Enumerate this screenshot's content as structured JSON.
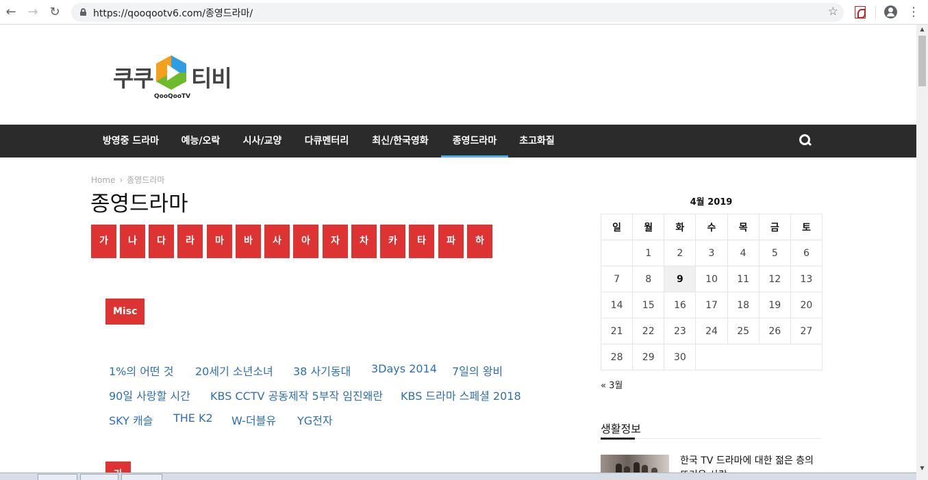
{
  "browser": {
    "url": "https://qooqootv6.com/종영드라마/"
  },
  "site": {
    "logo_ko_left": "쿠쿠",
    "logo_ko_right": "티비",
    "logo_en": "QooQooTV",
    "menu": [
      {
        "label": "방영중 드라마",
        "active": false
      },
      {
        "label": "예능/오락",
        "active": false
      },
      {
        "label": "시사/교양",
        "active": false
      },
      {
        "label": "다큐멘터리",
        "active": false
      },
      {
        "label": "최신/한국영화",
        "active": false
      },
      {
        "label": "종영드라마",
        "active": true
      },
      {
        "label": "초고화질",
        "active": false
      }
    ]
  },
  "breadcrumb": {
    "home": "Home",
    "arrow": "›",
    "current": "종영드라마"
  },
  "page_title": "종영드라마",
  "letters": [
    "가",
    "나",
    "다",
    "라",
    "마",
    "바",
    "사",
    "아",
    "자",
    "차",
    "카",
    "타",
    "파",
    "하"
  ],
  "sections": [
    {
      "label": "Misc",
      "links": [
        [
          "1%의 어떤 것",
          "20세기 소년소녀",
          "38 사기동대",
          "3Days 2014",
          "7일의 왕비"
        ],
        [
          "90일 사랑할 시간",
          "KBS CCTV 공동제작 5부작 임진왜란",
          "KBS 드라마 스페셜 2018"
        ],
        [
          "SKY 캐슬",
          "THE K2",
          "W-더블유",
          "YG전자"
        ]
      ]
    },
    {
      "label": "가"
    }
  ],
  "calendar": {
    "caption": "4월 2019",
    "weekdays": [
      "일",
      "월",
      "화",
      "수",
      "목",
      "금",
      "토"
    ],
    "weeks": [
      [
        "",
        "1",
        "2",
        "3",
        "4",
        "5",
        "6"
      ],
      [
        "7",
        "8",
        "9",
        "10",
        "11",
        "12",
        "13"
      ],
      [
        "14",
        "15",
        "16",
        "17",
        "18",
        "19",
        "20"
      ],
      [
        "21",
        "22",
        "23",
        "24",
        "25",
        "26",
        "27"
      ],
      [
        "28",
        "29",
        "30",
        "",
        "",
        "",
        ""
      ]
    ],
    "today": "9",
    "prev_link": "« 3월"
  },
  "widget": {
    "title": "생활정보",
    "post_title": "한국 TV 드라마에 대한 젊은 층의 뜨거운 사랑"
  },
  "colors": {
    "accent": "#dd3333",
    "menu_bg": "#2b2b2b",
    "link": "#2d6fb5",
    "active_underline": "#4db2ec"
  }
}
